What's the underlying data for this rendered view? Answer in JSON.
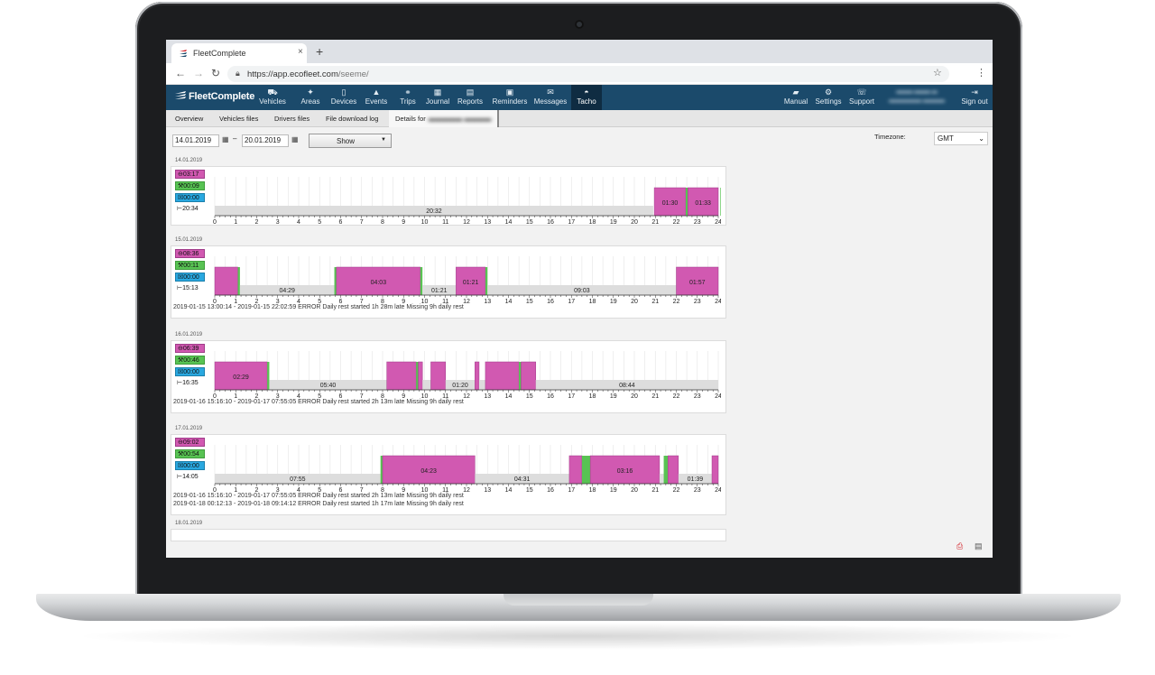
{
  "browser": {
    "tab_title": "FleetComplete",
    "tab_close": "×",
    "new_tab": "+",
    "url_host": "https://app.ecofleet.com",
    "url_path": "/seeme/"
  },
  "app": {
    "logo": "FleetComplete",
    "nav_left": [
      {
        "label": "Vehicles",
        "icon": "car-icon",
        "glyph": "⛟"
      },
      {
        "label": "Areas",
        "icon": "pin-icon",
        "glyph": "✦"
      },
      {
        "label": "Devices",
        "icon": "device-icon",
        "glyph": "▯"
      },
      {
        "label": "Events",
        "icon": "warning-icon",
        "glyph": "▲"
      },
      {
        "label": "Trips",
        "icon": "binoculars-icon",
        "glyph": "⚭"
      },
      {
        "label": "Journal",
        "icon": "calendar-icon",
        "glyph": "▦"
      },
      {
        "label": "Reports",
        "icon": "report-icon",
        "glyph": "▤"
      },
      {
        "label": "Reminders",
        "icon": "calendar-check-icon",
        "glyph": "▣"
      },
      {
        "label": "Messages",
        "icon": "envelope-icon",
        "glyph": "✉"
      },
      {
        "label": "Tacho",
        "icon": "speedometer-icon",
        "glyph": "◓"
      }
    ],
    "nav_right": [
      {
        "label": "Manual",
        "icon": "book-icon",
        "glyph": "▰"
      },
      {
        "label": "Settings",
        "icon": "gears-icon",
        "glyph": "⚙"
      },
      {
        "label": "Support",
        "icon": "chat-icon",
        "glyph": "☏"
      },
      {
        "label": "Sign out",
        "icon": "sign-out-icon",
        "glyph": "⇥"
      }
    ]
  },
  "subtabs": [
    "Overview",
    "Vehicles files",
    "Drivers files",
    "File download log",
    "Details for"
  ],
  "toolbar": {
    "date_from": "14.01.2019",
    "date_to": "20.01.2019",
    "dash": "–",
    "show_label": "Show",
    "timezone_label": "Timezone:",
    "timezone_value": "GMT"
  },
  "colors": {
    "driving": "#d159b1",
    "work": "#58c353",
    "available": "#29a8e0",
    "rest": "#dddddd",
    "nav": "#1b4a6b"
  },
  "days": [
    {
      "date": "14.01.2019",
      "totals": {
        "driving": "03:17",
        "work": "00:09",
        "available": "00:00",
        "rest": "20:34"
      },
      "segments": [
        {
          "type": "rest",
          "start": 0,
          "end": 20.9,
          "label": "20:32"
        },
        {
          "type": "drive",
          "start": 20.95,
          "end": 22.45,
          "label": "01:30"
        },
        {
          "type": "work",
          "start": 22.45,
          "end": 22.55,
          "label": ""
        },
        {
          "type": "drive",
          "start": 22.55,
          "end": 24.1,
          "label": "01:33"
        },
        {
          "type": "work",
          "start": 24.1,
          "end": 24.2,
          "label": ""
        },
        {
          "type": "drive",
          "start": 24.2,
          "end": 24.4,
          "label": ""
        }
      ],
      "errors": []
    },
    {
      "date": "15.01.2019",
      "totals": {
        "driving": "08:36",
        "work": "00:11",
        "available": "00:00",
        "rest": "15:13"
      },
      "segments": [
        {
          "type": "drive",
          "start": 0,
          "end": 1.1,
          "label": ""
        },
        {
          "type": "work",
          "start": 1.1,
          "end": 1.2,
          "label": ""
        },
        {
          "type": "rest",
          "start": 1.2,
          "end": 5.7,
          "label": "04:29"
        },
        {
          "type": "work",
          "start": 5.7,
          "end": 5.8,
          "label": ""
        },
        {
          "type": "drive",
          "start": 5.8,
          "end": 9.8,
          "label": "04:03"
        },
        {
          "type": "work",
          "start": 9.8,
          "end": 9.9,
          "label": ""
        },
        {
          "type": "rest",
          "start": 9.9,
          "end": 11.5,
          "label": "01:21"
        },
        {
          "type": "drive",
          "start": 11.5,
          "end": 12.9,
          "label": "01:21"
        },
        {
          "type": "work",
          "start": 12.9,
          "end": 13.0,
          "label": ""
        },
        {
          "type": "rest",
          "start": 13.0,
          "end": 22.0,
          "label": "09:03"
        },
        {
          "type": "drive",
          "start": 22.0,
          "end": 24.0,
          "label": "01:57"
        }
      ],
      "errors": [
        "2019-01-15 13:00:14 - 2019-01-15 22:02:59 ERROR Daily rest started 1h 28m late Missing 9h daily rest"
      ]
    },
    {
      "date": "16.01.2019",
      "totals": {
        "driving": "06:39",
        "work": "00:46",
        "available": "00:00",
        "rest": "16:35"
      },
      "segments": [
        {
          "type": "drive",
          "start": 0,
          "end": 2.5,
          "label": "02:29"
        },
        {
          "type": "work",
          "start": 2.5,
          "end": 2.6,
          "label": ""
        },
        {
          "type": "rest",
          "start": 2.6,
          "end": 8.2,
          "label": "05:40"
        },
        {
          "type": "drive",
          "start": 8.2,
          "end": 9.6,
          "label": ""
        },
        {
          "type": "work",
          "start": 9.6,
          "end": 9.7,
          "label": ""
        },
        {
          "type": "drive",
          "start": 9.7,
          "end": 9.9,
          "label": ""
        },
        {
          "type": "rest",
          "start": 9.9,
          "end": 10.3,
          "label": ""
        },
        {
          "type": "drive",
          "start": 10.3,
          "end": 11.0,
          "label": ""
        },
        {
          "type": "rest",
          "start": 11.0,
          "end": 12.4,
          "label": "01:20"
        },
        {
          "type": "drive",
          "start": 12.4,
          "end": 12.6,
          "label": ""
        },
        {
          "type": "rest",
          "start": 12.6,
          "end": 12.9,
          "label": ""
        },
        {
          "type": "drive",
          "start": 12.9,
          "end": 14.5,
          "label": ""
        },
        {
          "type": "work",
          "start": 14.5,
          "end": 14.6,
          "label": ""
        },
        {
          "type": "drive",
          "start": 14.6,
          "end": 15.3,
          "label": ""
        },
        {
          "type": "rest",
          "start": 15.3,
          "end": 24.0,
          "label": "08:44"
        }
      ],
      "errors": [
        "2019-01-16 15:16:10 - 2019-01-17 07:55:05 ERROR Daily rest started 2h 13m late Missing 9h daily rest"
      ]
    },
    {
      "date": "17.01.2019",
      "totals": {
        "driving": "09:02",
        "work": "00:54",
        "available": "00:00",
        "rest": "14:05"
      },
      "segments": [
        {
          "type": "rest",
          "start": 0,
          "end": 7.9,
          "label": "07:55"
        },
        {
          "type": "work",
          "start": 7.9,
          "end": 8.0,
          "label": ""
        },
        {
          "type": "drive",
          "start": 8.0,
          "end": 12.4,
          "label": "04:23"
        },
        {
          "type": "rest",
          "start": 12.4,
          "end": 16.9,
          "label": "04:31"
        },
        {
          "type": "drive",
          "start": 16.9,
          "end": 17.5,
          "label": ""
        },
        {
          "type": "work",
          "start": 17.5,
          "end": 17.9,
          "label": ""
        },
        {
          "type": "drive",
          "start": 17.9,
          "end": 21.2,
          "label": "03:16"
        },
        {
          "type": "rest",
          "start": 21.2,
          "end": 21.4,
          "label": ""
        },
        {
          "type": "work",
          "start": 21.4,
          "end": 21.6,
          "label": ""
        },
        {
          "type": "drive",
          "start": 21.6,
          "end": 22.1,
          "label": ""
        },
        {
          "type": "rest",
          "start": 22.1,
          "end": 23.7,
          "label": "01:39"
        },
        {
          "type": "drive",
          "start": 23.7,
          "end": 24.0,
          "label": ""
        }
      ],
      "errors": [
        "2019-01-16 15:16:10 - 2019-01-17 07:55:05 ERROR Daily rest started 2h 13m late Missing 9h daily rest",
        "2019-01-18 00:12:13 - 2019-01-18 09:14:12 ERROR Daily rest started 1h 17m late Missing 9h daily rest"
      ]
    },
    {
      "date": "18.01.2019",
      "totals": {},
      "segments": [],
      "errors": []
    }
  ],
  "hour_ticks": [
    "0",
    "1",
    "2",
    "3",
    "4",
    "5",
    "6",
    "7",
    "8",
    "9",
    "10",
    "11",
    "12",
    "13",
    "14",
    "15",
    "16",
    "17",
    "18",
    "19",
    "20",
    "21",
    "22",
    "23",
    "24"
  ]
}
